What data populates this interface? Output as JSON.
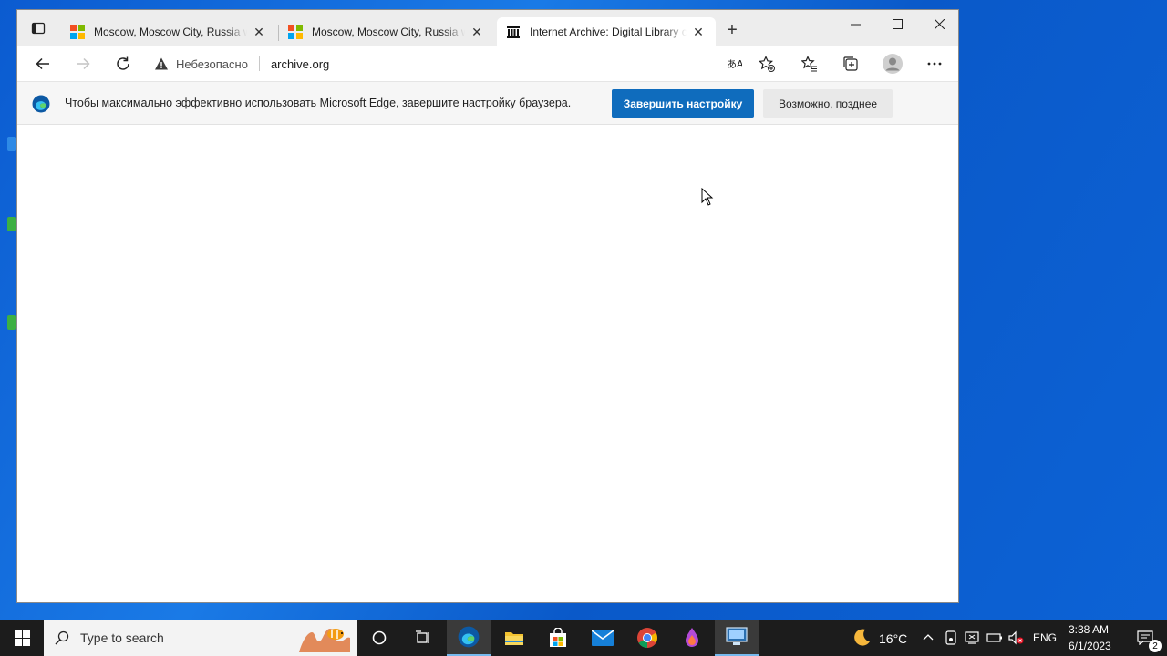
{
  "browser": {
    "tabs": [
      {
        "title": "Moscow, Moscow City, Russia w",
        "favicon": "microsoft-logo",
        "active": false
      },
      {
        "title": "Moscow, Moscow City, Russia w",
        "favicon": "microsoft-logo",
        "active": false
      },
      {
        "title": "Internet Archive: Digital Library c",
        "favicon": "archive-logo",
        "active": true
      }
    ],
    "new_tab_label": "+",
    "address": {
      "security_label": "Небезопасно",
      "url": "archive.org"
    },
    "infobar": {
      "message": "Чтобы максимально эффективно использовать Microsoft Edge, завершите настройку браузера.",
      "primary_button": "Завершить настройку",
      "secondary_button": "Возможно, позднее"
    }
  },
  "taskbar": {
    "search_placeholder": "Type to search",
    "weather_temp": "16°C",
    "language": "ENG",
    "time": "3:38 AM",
    "date": "6/1/2023",
    "notification_count": "2"
  },
  "colors": {
    "accent": "#0f6cbd",
    "taskbar": "#1c1c1c",
    "desktop": "#0b5bd0"
  }
}
